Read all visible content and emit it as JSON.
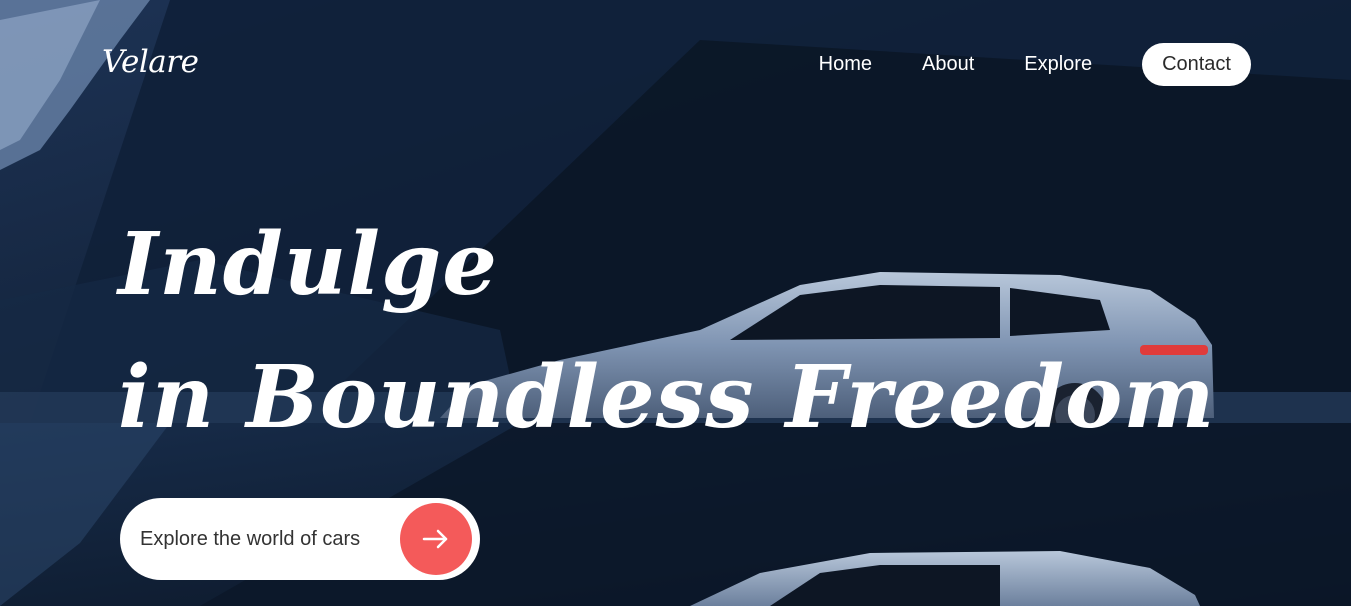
{
  "brand": {
    "logo": "Velare"
  },
  "nav": {
    "items": [
      {
        "label": "Home"
      },
      {
        "label": "About"
      },
      {
        "label": "Explore"
      }
    ],
    "contact_label": "Contact"
  },
  "hero": {
    "line1": "Indulge",
    "line2": "in Boundless Freedom"
  },
  "cta": {
    "label": "Explore the world of cars",
    "icon": "arrow-right-icon"
  },
  "colors": {
    "background": "#0d1b2e",
    "accent": "#f45a5a",
    "text": "#ffffff",
    "car": "#8ea3bf"
  }
}
